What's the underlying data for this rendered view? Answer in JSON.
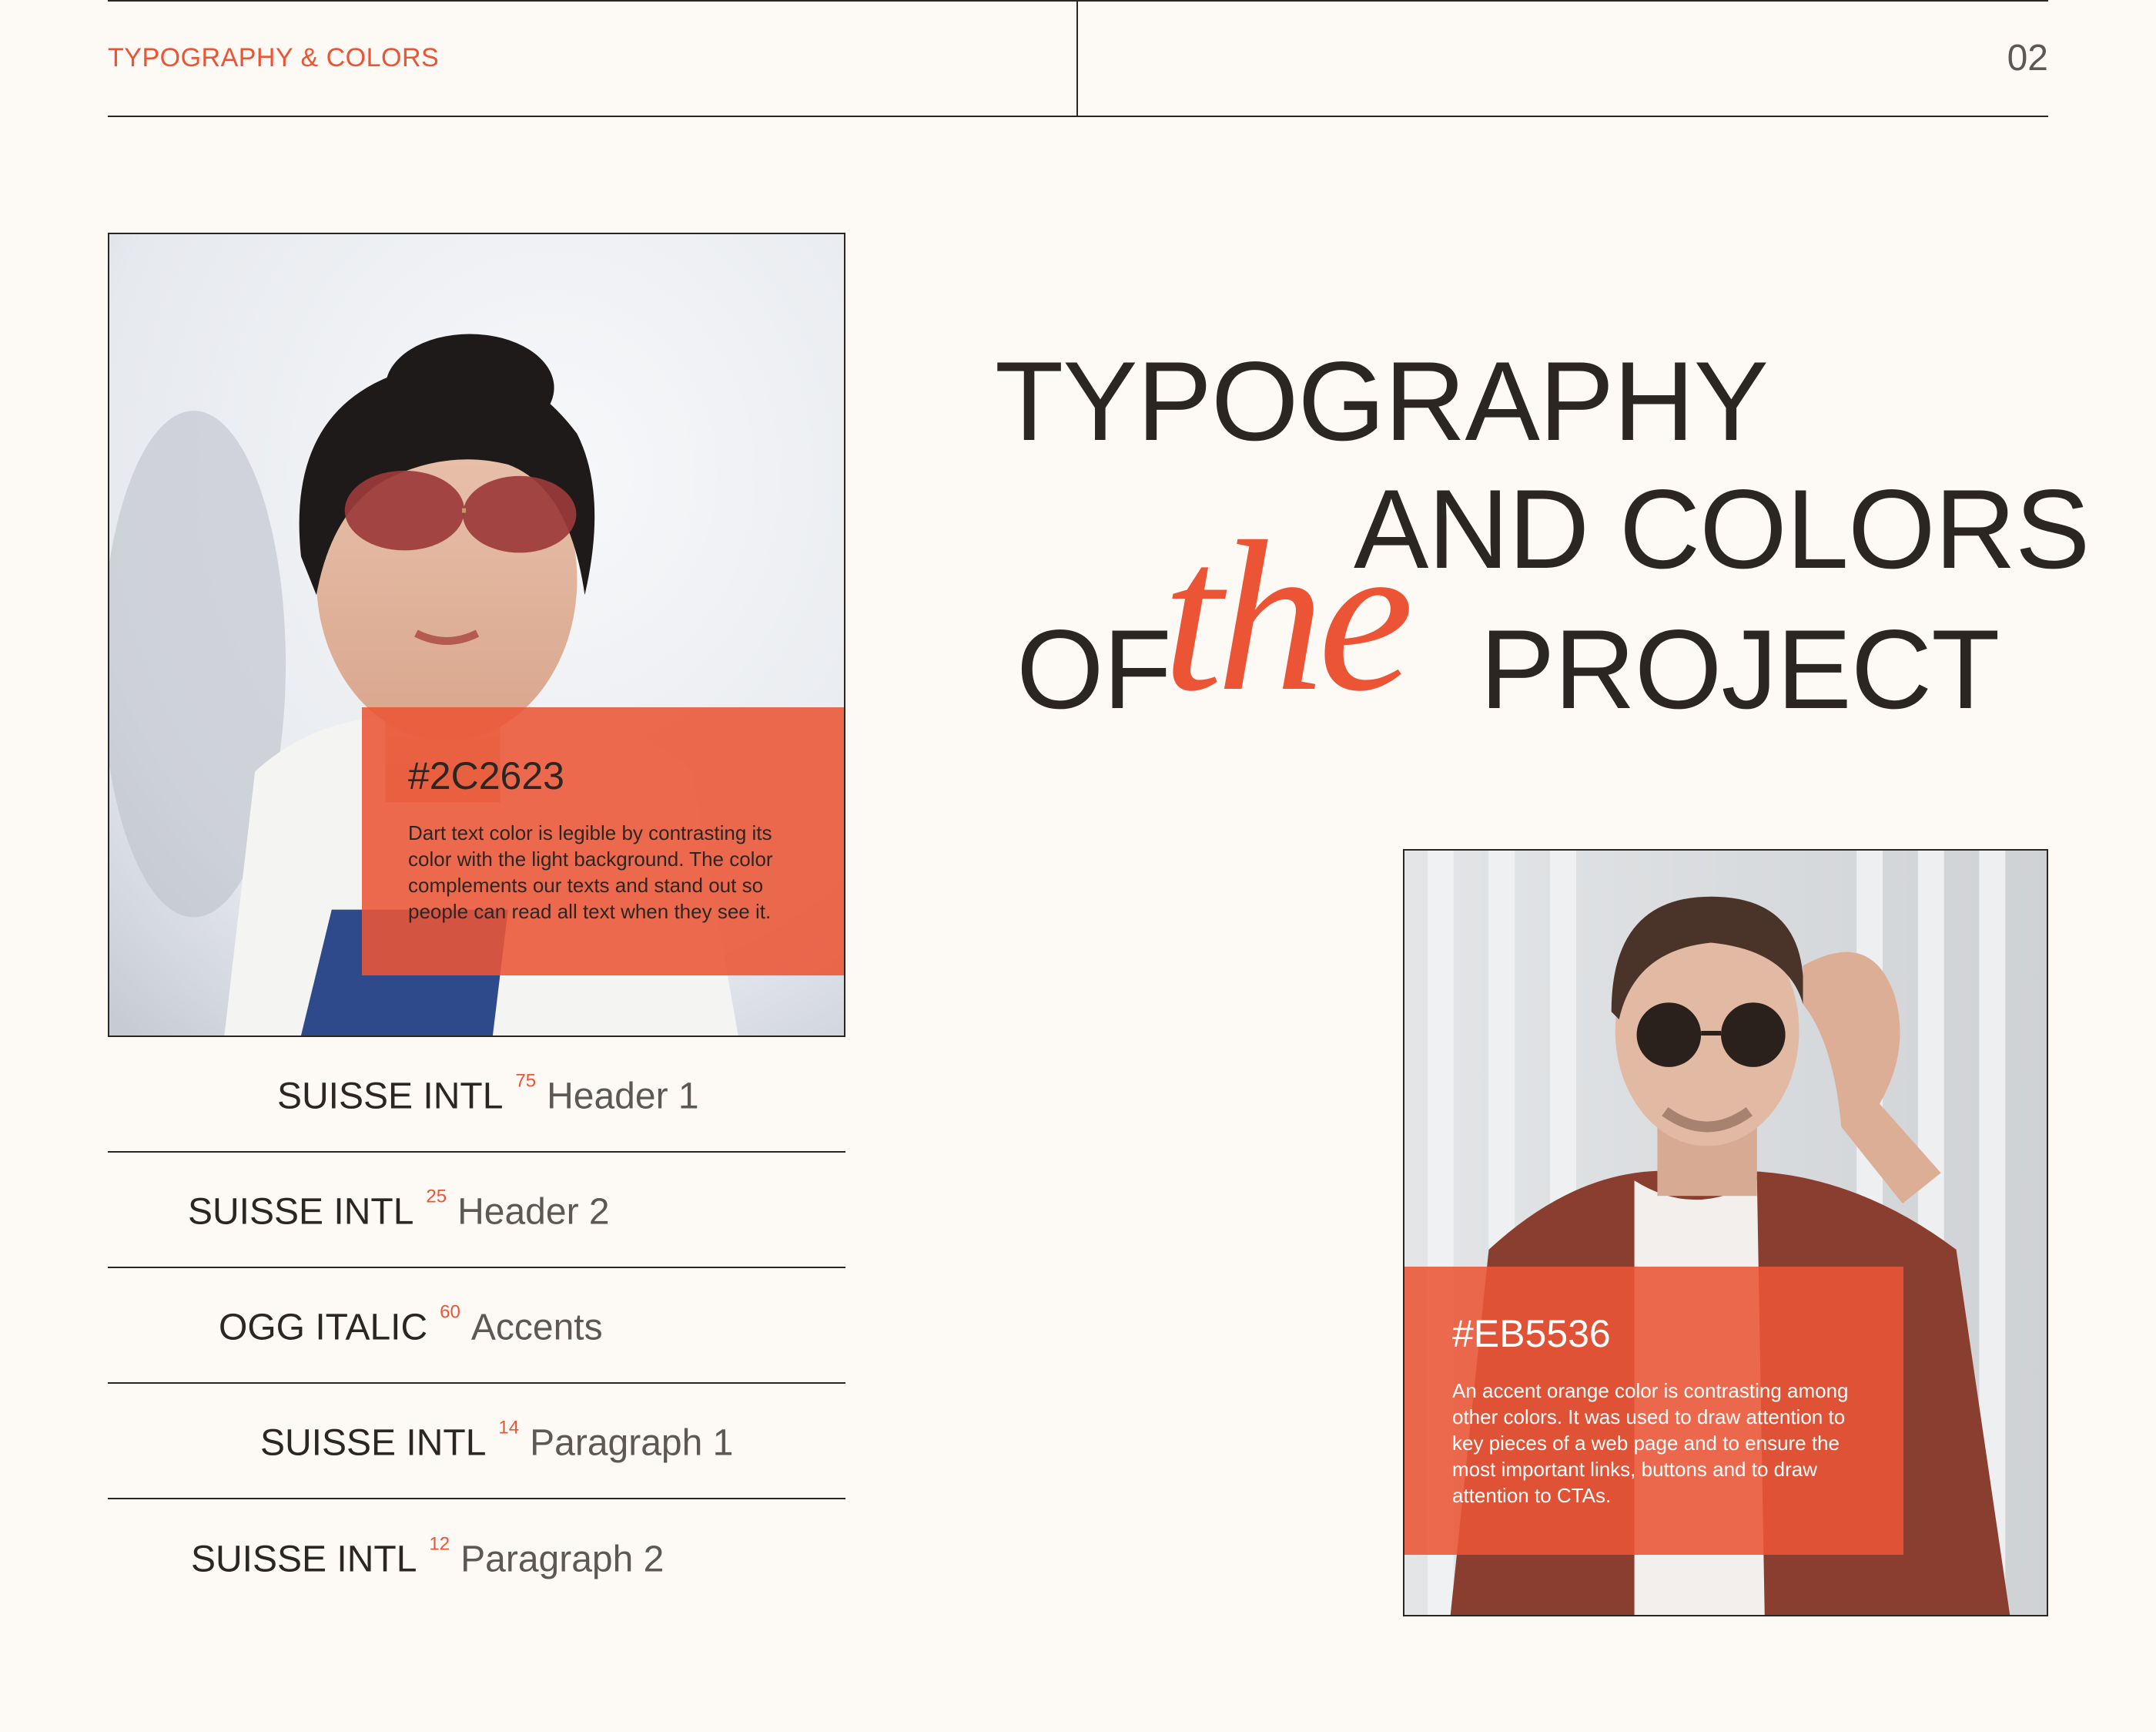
{
  "header": {
    "section_title": "TYPOGRAPHY & COLORS",
    "page_number": "02"
  },
  "title": {
    "line1": "TYPOGRAPHY",
    "line2": "AND COLORS",
    "line3_before": "OF",
    "accent_word": "the",
    "line3_after": "PROJECT"
  },
  "colors": [
    {
      "hex": "#2C2623",
      "description": "Dart text color is legible by contrasting its color with the light background. The color complements our texts and stand out so people can read all text when they see it."
    },
    {
      "hex": "#EB5536",
      "description": "An accent orange color is contrasting among other colors. It was used to draw attention to key pieces of a web page and to ensure the most important links, buttons and to draw attention to CTAs."
    }
  ],
  "type_scale": [
    {
      "font": "SUISSE INTL",
      "size": "75",
      "role": "Header 1"
    },
    {
      "font": "SUISSE INTL",
      "size": "25",
      "role": "Header 2"
    },
    {
      "font": "OGG ITALIC",
      "size": "60",
      "role": "Accents"
    },
    {
      "font": "SUISSE INTL",
      "size": "14",
      "role": "Paragraph 1"
    },
    {
      "font": "SUISSE INTL",
      "size": "12",
      "role": "Paragraph 2"
    }
  ],
  "palette": {
    "dark": "#2C2623",
    "accent": "#EB5536",
    "background": "#FDFAF6"
  },
  "images": {
    "left_photo": "woman-with-sunglasses-photo",
    "right_photo": "man-with-sunglasses-photo"
  }
}
